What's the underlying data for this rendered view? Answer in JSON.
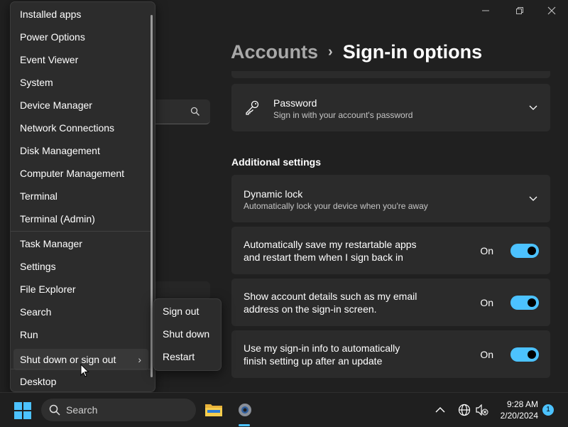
{
  "settings": {
    "breadcrumb_parent": "Accounts",
    "breadcrumb_separator": "›",
    "breadcrumb_current": "Sign-in options",
    "password": {
      "title": "Password",
      "description": "Sign in with your account's password"
    },
    "additional_settings_heading": "Additional settings",
    "dynamic_lock": {
      "title": "Dynamic lock",
      "description": "Automatically lock your device when you're away"
    },
    "toggles": [
      {
        "line1": "Automatically save my restartable apps",
        "line2": "and restart them when I sign back in",
        "state": "On"
      },
      {
        "line1": "Show account details such as my email",
        "line2": "address on the sign-in screen.",
        "state": "On"
      },
      {
        "line1": "Use my sign-in info to automatically",
        "line2": "finish setting up after an update",
        "state": "On"
      }
    ]
  },
  "context_menu": {
    "items": [
      "Installed apps",
      "Power Options",
      "Event Viewer",
      "System",
      "Device Manager",
      "Network Connections",
      "Disk Management",
      "Computer Management",
      "Terminal",
      "Terminal (Admin)",
      "Task Manager",
      "Settings",
      "File Explorer",
      "Search",
      "Run",
      "Shut down or sign out",
      "Desktop"
    ],
    "submenu_arrow": "›",
    "submenu": [
      "Sign out",
      "Shut down",
      "Restart"
    ]
  },
  "taskbar": {
    "search_label": "Search",
    "time": "9:28 AM",
    "date": "2/20/2024",
    "notification_count": "1"
  },
  "colors": {
    "accent": "#4cc2ff",
    "background": "#202020",
    "card": "#2b2b2b",
    "menu": "#2c2c2c"
  }
}
